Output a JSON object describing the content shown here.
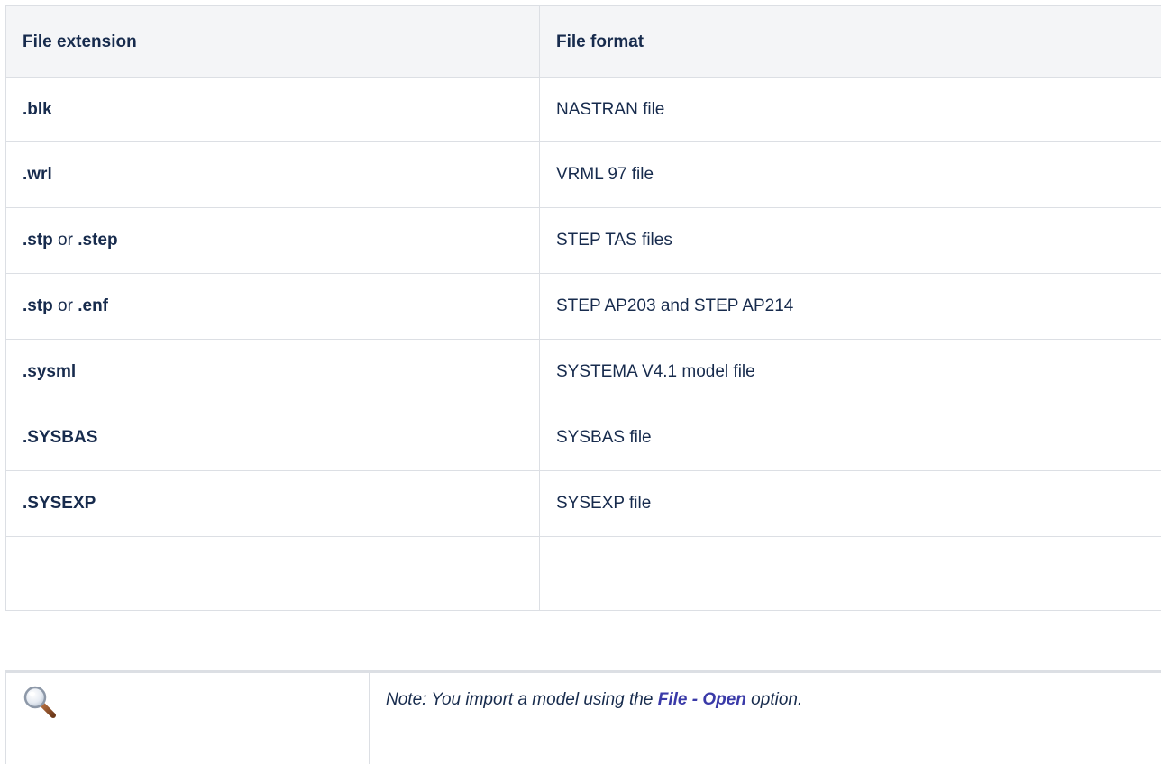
{
  "table": {
    "headers": [
      "File extension",
      "File format"
    ],
    "rows": [
      {
        "ext1": ".blk",
        "sep": "",
        "ext2": "",
        "format": "NASTRAN file"
      },
      {
        "ext1": ".wrl",
        "sep": "",
        "ext2": "",
        "format": "VRML 97 file"
      },
      {
        "ext1": ".stp",
        "sep": " or ",
        "ext2": ".step",
        "format": "STEP TAS files"
      },
      {
        "ext1": ".stp",
        "sep": " or ",
        "ext2": ".enf",
        "format": "STEP AP203 and STEP AP214"
      },
      {
        "ext1": ".sysml",
        "sep": "",
        "ext2": "",
        "format": "SYSTEMA V4.1 model file"
      },
      {
        "ext1": ".SYSBAS",
        "sep": "",
        "ext2": "",
        "format": "SYSBAS file"
      },
      {
        "ext1": ".SYSEXP",
        "sep": "",
        "ext2": "",
        "format": "SYSEXP file"
      },
      {
        "ext1": "",
        "sep": "",
        "ext2": "",
        "format": ""
      }
    ]
  },
  "note": {
    "icon": "magnifier-icon",
    "prefix": "Note: You import a model using the ",
    "link": "File - Open",
    "suffix": " option."
  },
  "colors": {
    "header_bg": "#f4f5f7",
    "border": "#dcdfe4",
    "text": "#172b4d",
    "link": "#3a3aa8"
  }
}
